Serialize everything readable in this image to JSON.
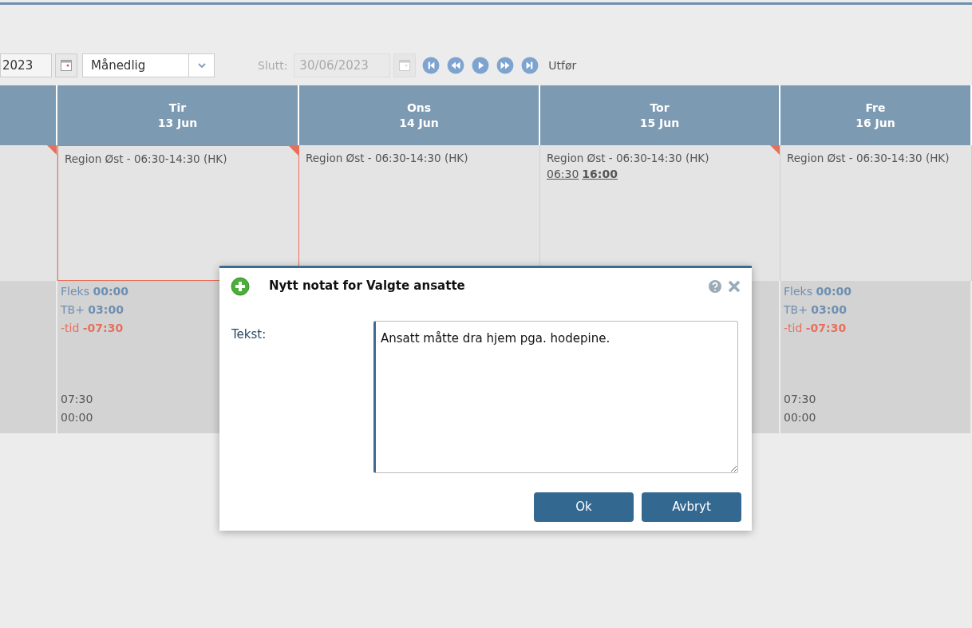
{
  "toolbar": {
    "start_date": "2023",
    "period": "Månedlig",
    "end_label": "Slutt:",
    "end_date": "30/06/2023",
    "end_disabled": true,
    "run": "Utfør"
  },
  "first_column": {
    "flagged": true
  },
  "days": [
    {
      "weekday": "Tir",
      "date": "13 Jun",
      "shift": "Region Øst - 06:30-14:30 (HK)",
      "flagged": true,
      "selected": true,
      "summary": {
        "lines": [
          {
            "label": "Fleks",
            "value": "00:00",
            "kind": "balance"
          },
          {
            "label": "TB+",
            "value": "03:00",
            "kind": "balance"
          },
          {
            "label": "-tid",
            "value": "-07:30",
            "kind": "deficit"
          }
        ],
        "totals": [
          "07:30",
          "00:00"
        ]
      }
    },
    {
      "weekday": "Ons",
      "date": "14 Jun",
      "shift": "Region Øst - 06:30-14:30 (HK)",
      "flagged": false,
      "selected": false
    },
    {
      "weekday": "Tor",
      "date": "15 Jun",
      "shift": "Region Øst - 06:30-14:30 (HK)",
      "flagged": true,
      "selected": false,
      "punch": {
        "in": "06:30",
        "out": "16:00"
      }
    },
    {
      "weekday": "Fre",
      "date": "16 Jun",
      "shift": "Region Øst - 06:30-14:30 (HK)",
      "flagged": false,
      "selected": false,
      "summary": {
        "lines": [
          {
            "label": "Fleks",
            "value": "00:00",
            "kind": "balance"
          },
          {
            "label": "TB+",
            "value": "03:00",
            "kind": "balance"
          },
          {
            "label": "-tid",
            "value": "-07:30",
            "kind": "deficit"
          }
        ],
        "totals": [
          "07:30",
          "00:00"
        ]
      }
    }
  ],
  "dialog": {
    "title": "Nytt notat for Valgte ansatte",
    "field_label": "Tekst:",
    "value": "Ansatt måtte dra hjem pga. hodepine.",
    "buttons": [
      "Ok",
      "Avbryt"
    ]
  }
}
